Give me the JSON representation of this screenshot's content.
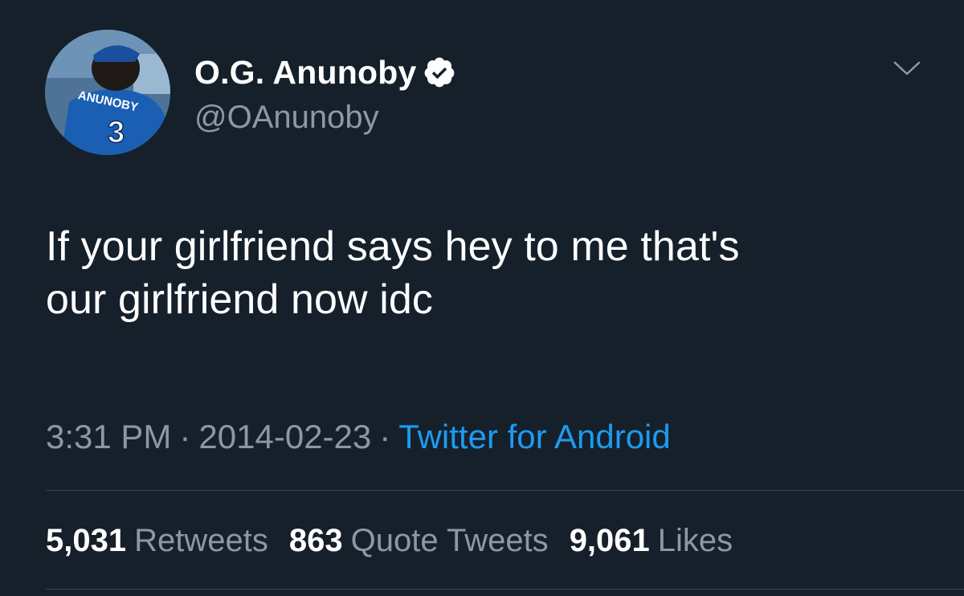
{
  "user": {
    "display_name": "O.G. Anunoby",
    "handle": "@OAnunoby",
    "verified": true,
    "avatar_jersey_name": "ANUNOBY",
    "avatar_jersey_number": "3"
  },
  "tweet": {
    "text": "If your girlfriend says hey to me that's\nour girlfriend now idc",
    "time": "3:31 PM",
    "date": "2014-02-23",
    "separator": "·",
    "source": "Twitter for Android"
  },
  "stats": {
    "retweets_count": "5,031",
    "retweets_label": "Retweets",
    "quotes_count": "863",
    "quotes_label": "Quote Tweets",
    "likes_count": "9,061",
    "likes_label": "Likes"
  },
  "icons": {
    "verified": "verified-badge-icon",
    "more": "chevron-down-icon"
  },
  "colors": {
    "background": "#15202b",
    "secondary_text": "#8b98a5",
    "link": "#1d9bf0",
    "divider": "#38444d",
    "jersey_blue": "#1a5fb4"
  }
}
